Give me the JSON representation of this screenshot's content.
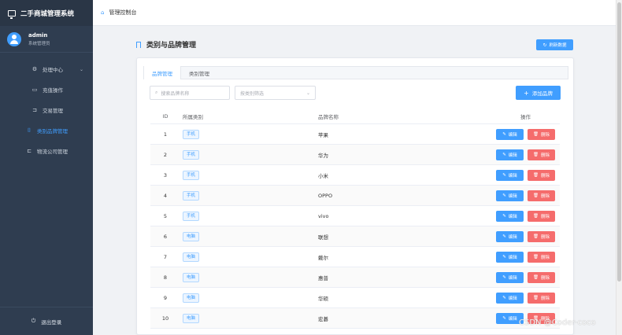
{
  "app": {
    "title": "二手商城管理系统"
  },
  "user": {
    "name": "admin",
    "role": "系统管理员"
  },
  "sidebar": {
    "items": [
      {
        "label": "处理中心",
        "icon": "gear-icon"
      },
      {
        "label": "充值操作",
        "icon": "recharge-icon"
      },
      {
        "label": "交易管理",
        "icon": "cart-icon"
      },
      {
        "label": "类别品牌管理",
        "icon": "bookmark-icon"
      },
      {
        "label": "物流公司管理",
        "icon": "truck-icon"
      }
    ],
    "logout": "退出登录"
  },
  "header": {
    "breadcrumb": "管理控制台"
  },
  "page": {
    "title": "类别与品牌管理",
    "refresh_label": "刷新数据"
  },
  "tabs": [
    {
      "label": "品牌管理"
    },
    {
      "label": "类别管理"
    }
  ],
  "filters": {
    "search_placeholder": "搜索品牌名称",
    "category_placeholder": "按类别筛选",
    "add_label": "添加品牌"
  },
  "table": {
    "headers": {
      "id": "ID",
      "category": "所属类别",
      "name": "品牌名称",
      "ops": "操作"
    },
    "edit_label": "编辑",
    "delete_label": "删除",
    "rows": [
      {
        "id": "1",
        "category": "手机",
        "name": "苹果"
      },
      {
        "id": "2",
        "category": "手机",
        "name": "华为"
      },
      {
        "id": "3",
        "category": "手机",
        "name": "小米"
      },
      {
        "id": "4",
        "category": "手机",
        "name": "OPPO"
      },
      {
        "id": "5",
        "category": "手机",
        "name": "vivo"
      },
      {
        "id": "6",
        "category": "电脑",
        "name": "联想"
      },
      {
        "id": "7",
        "category": "电脑",
        "name": "戴尔"
      },
      {
        "id": "8",
        "category": "电脑",
        "name": "惠普"
      },
      {
        "id": "9",
        "category": "电脑",
        "name": "华硕"
      },
      {
        "id": "10",
        "category": "电脑",
        "name": "宏碁"
      }
    ]
  },
  "watermark": "CSDN @Coder-coco",
  "colors": {
    "primary": "#409eff",
    "danger": "#f56c6c",
    "sidebar": "#2f3d50"
  }
}
